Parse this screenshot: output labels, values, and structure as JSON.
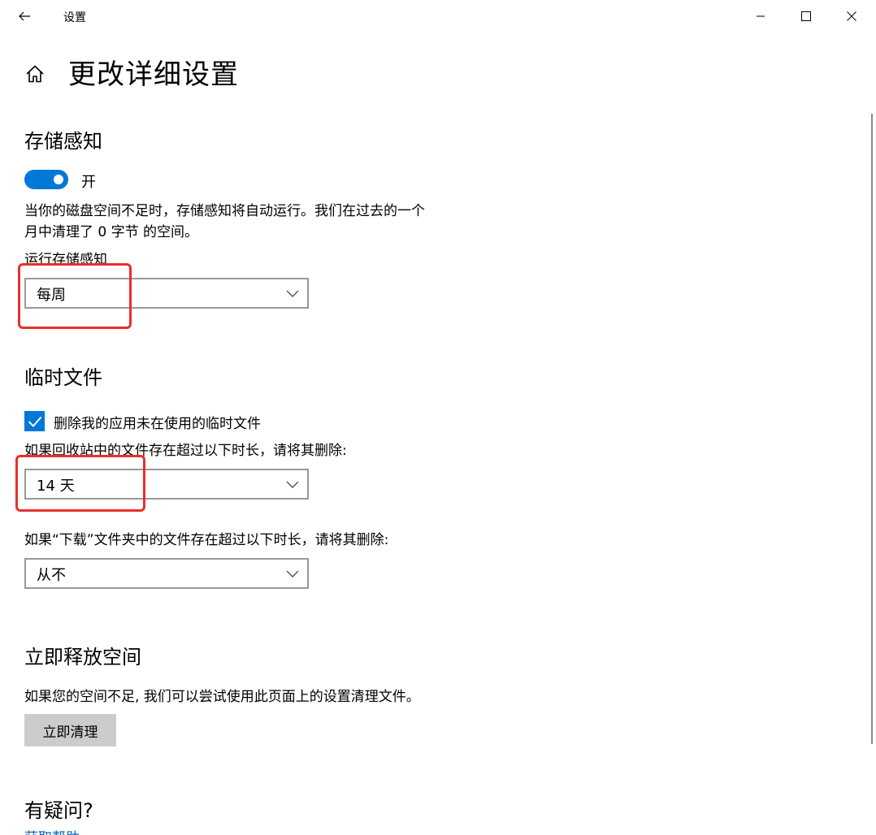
{
  "app": {
    "title": "设置"
  },
  "page": {
    "title": "更改详细设置"
  },
  "storage_sense": {
    "heading": "存储感知",
    "toggle_state": "开",
    "toggle_on": true,
    "description_line1": "当你的磁盘空间不足时，存储感知将自动运行。我们在过去的一个",
    "description_line2": "月中清理了 0 字节 的空间。",
    "run_label": "运行存储感知",
    "run_value": "每周"
  },
  "temp_files": {
    "heading": "临时文件",
    "checkbox_label": "删除我的应用未在使用的临时文件",
    "checkbox_checked": true,
    "recycle_label": "如果回收站中的文件存在超过以下时长，请将其删除:",
    "recycle_value": "14 天",
    "downloads_label": "如果“下载”文件夹中的文件存在超过以下时长，请将其删除:",
    "downloads_value": "从不"
  },
  "free_space": {
    "heading": "立即释放空间",
    "description": "如果您的空间不足, 我们可以尝试使用此页面上的设置清理文件。",
    "button_label": "立即清理"
  },
  "questions": {
    "heading": "有疑问?",
    "help_link": "获取帮助"
  },
  "colors": {
    "accent": "#0078d7",
    "highlight": "#e8302c",
    "button_bg": "#cccccc",
    "link": "#0067b8"
  },
  "icons": {
    "back": "arrow-left-icon",
    "home": "home-icon",
    "minimize": "minimize-icon",
    "maximize": "maximize-icon",
    "close": "close-icon",
    "chevron": "chevron-down-icon",
    "check": "checkmark-icon"
  }
}
